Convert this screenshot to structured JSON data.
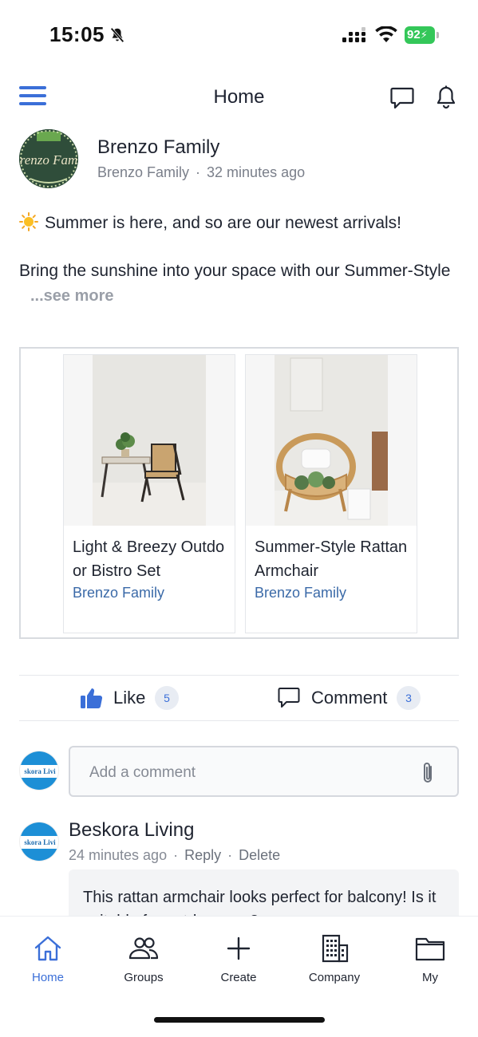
{
  "status_bar": {
    "time": "15:05",
    "battery": "92"
  },
  "header": {
    "title": "Home"
  },
  "post": {
    "author": "Brenzo Family",
    "avatar_text": "renzo Fam",
    "meta_author": "Brenzo Family",
    "separator": "·",
    "time_ago": "32 minutes ago",
    "line1": "Summer is here, and so are our newest arrivals!",
    "line2": "Bring the sunshine into your space with our Summer-Style",
    "see_more": "...see more"
  },
  "products": [
    {
      "name": "Light & Breezy Outdoor Bistro Set",
      "seller": "Brenzo Family"
    },
    {
      "name": "Summer-Style Rattan Armchair",
      "seller": "Brenzo Family"
    }
  ],
  "actions": {
    "like_label": "Like",
    "like_count": "5",
    "comment_label": "Comment",
    "comment_count": "3"
  },
  "comment_input": {
    "placeholder": "Add a comment",
    "avatar_text": "skora Livi"
  },
  "comment": {
    "author": "Beskora Living",
    "avatar_text": "skora Livi",
    "time_ago": "24 minutes ago",
    "separator": "·",
    "reply_label": "Reply",
    "delete_label": "Delete",
    "text": "This rattan armchair looks perfect for balcony! Is it suitable for outdoor use?"
  },
  "bottom_nav": {
    "items": [
      {
        "label": "Home",
        "icon": "home-icon",
        "active": true
      },
      {
        "label": "Groups",
        "icon": "groups-icon",
        "active": false
      },
      {
        "label": "Create",
        "icon": "plus-icon",
        "active": false
      },
      {
        "label": "Company",
        "icon": "building-icon",
        "active": false
      },
      {
        "label": "My",
        "icon": "folder-icon",
        "active": false
      }
    ]
  },
  "colors": {
    "accent": "#3b6fd8",
    "seller_link": "#3b6aa8",
    "battery": "#34c759",
    "muted_text": "#7a7f8a"
  }
}
